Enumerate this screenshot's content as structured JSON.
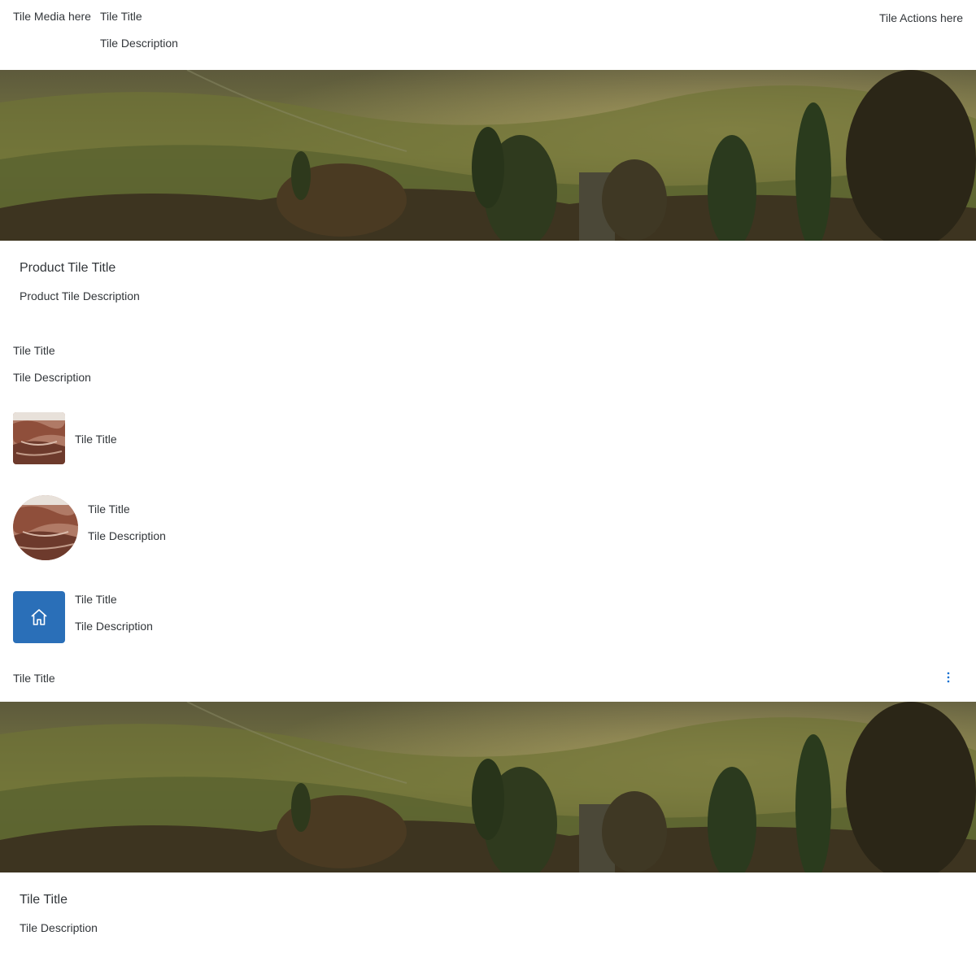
{
  "tile1": {
    "media": "Tile Media here",
    "title": "Tile Title",
    "description": "Tile Description",
    "actions": "Tile Actions here"
  },
  "product_tile": {
    "title": "Product Tile Title",
    "description": "Product Tile Description"
  },
  "tile2": {
    "title": "Tile Title",
    "description": "Tile Description"
  },
  "tile3": {
    "title": "Tile Title"
  },
  "tile4": {
    "title": "Tile Title",
    "description": "Tile Description"
  },
  "tile5": {
    "title": "Tile Title",
    "description": "Tile Description",
    "icon": "home-icon",
    "icon_bg": "#2a6fb8"
  },
  "tile6": {
    "title": "Tile Title",
    "action_icon": "overflow-menu-icon",
    "action_color": "#0a6ed1"
  },
  "tile7": {
    "title": "Tile Title",
    "description": "Tile Description"
  }
}
